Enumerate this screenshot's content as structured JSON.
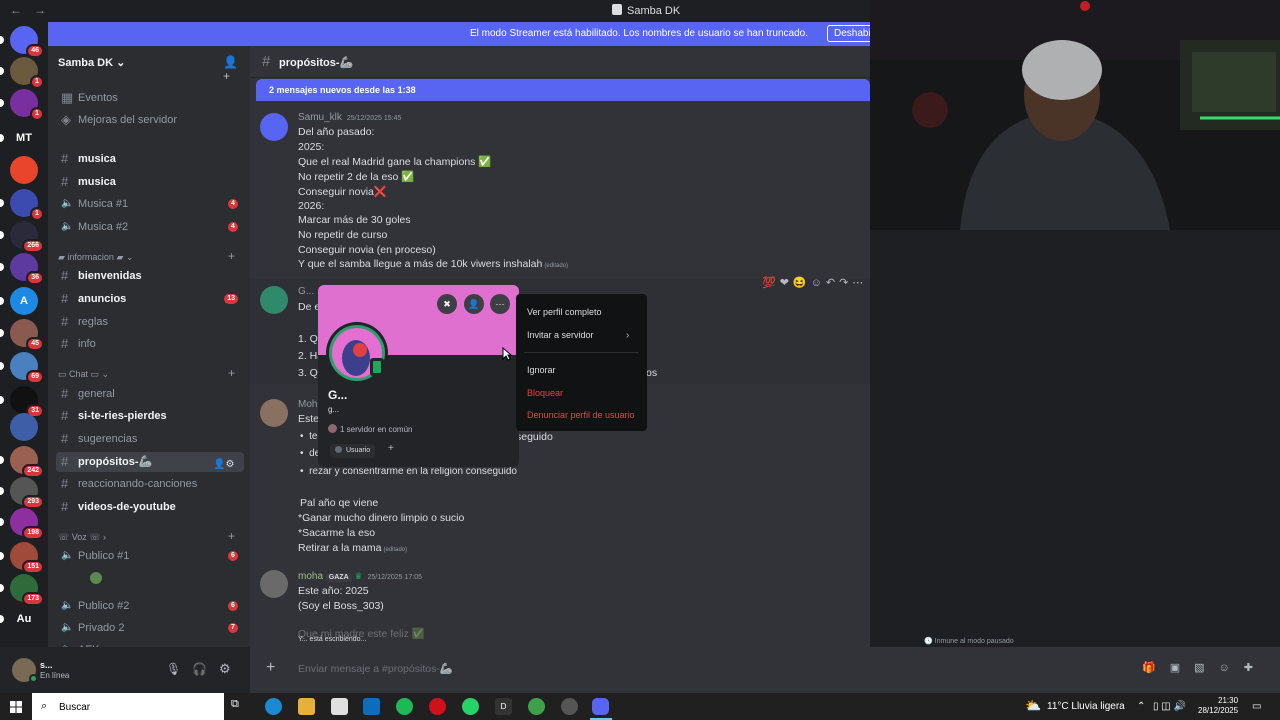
{
  "window": {
    "title": "Samba DK"
  },
  "streamer": {
    "message": "El modo Streamer está habilitado. Los nombres de usuario se han truncado.",
    "button": "Deshabilitar"
  },
  "rail": {
    "servers": [
      {
        "label": "",
        "badge": "46",
        "color": "#5865f2"
      },
      {
        "label": "",
        "badge": "1",
        "color": "#6b5a3d"
      },
      {
        "label": "",
        "badge": "1",
        "color": "#7a2fa0"
      },
      {
        "label": "MT",
        "badge": "",
        "color": "#1e1f22"
      },
      {
        "label": "",
        "badge": "",
        "color": "#e8452c"
      },
      {
        "label": "",
        "badge": "1",
        "color": "#3b4bb0"
      },
      {
        "label": "",
        "badge": "266",
        "color": "#2a2a3a"
      },
      {
        "label": "",
        "badge": "36",
        "color": "#5d3aa0"
      },
      {
        "label": "A",
        "badge": "",
        "color": "#1e88e5"
      },
      {
        "label": "",
        "badge": "45",
        "color": "#8a5a50"
      },
      {
        "label": "",
        "badge": "69",
        "color": "#4a7fc0"
      },
      {
        "label": "",
        "badge": "31",
        "color": "#111111"
      },
      {
        "label": "",
        "badge": "",
        "color": "#3e5fa8"
      },
      {
        "label": "",
        "badge": "242",
        "color": "#9a6050"
      },
      {
        "label": "",
        "badge": "293",
        "color": "#555555"
      },
      {
        "label": "",
        "badge": "198",
        "color": "#8e2fa0"
      },
      {
        "label": "",
        "badge": "151",
        "color": "#a04a3a"
      },
      {
        "label": "",
        "badge": "173",
        "color": "#2e6a3a"
      },
      {
        "label": "Au",
        "badge": "",
        "color": "#1e1f22"
      }
    ]
  },
  "sidebar": {
    "server_name": "Samba DK",
    "top_items": [
      "Eventos",
      "Mejoras del servidor"
    ],
    "categories": {
      "info": "informacion",
      "chat": "Chat",
      "voz": "Voz"
    },
    "channels": [
      {
        "name": "musica",
        "type": "text",
        "bold": true
      },
      {
        "name": "musica",
        "type": "text",
        "bold": true
      },
      {
        "name": "Musica #1",
        "type": "voice",
        "count": "4"
      },
      {
        "name": "Musica #2",
        "type": "voice",
        "count": "4"
      },
      {
        "name": "bienvenidas",
        "type": "text",
        "bold": true
      },
      {
        "name": "anuncios",
        "type": "text",
        "bold": true,
        "count": "13"
      },
      {
        "name": "reglas",
        "type": "text"
      },
      {
        "name": "info",
        "type": "text"
      },
      {
        "name": "general",
        "type": "text"
      },
      {
        "name": "si-te-ries-pierdes",
        "type": "text",
        "bold": true
      },
      {
        "name": "sugerencias",
        "type": "text"
      },
      {
        "name": "propósitos-🦾",
        "type": "text",
        "selected": true
      },
      {
        "name": "reaccionando-canciones",
        "type": "text"
      },
      {
        "name": "videos-de-youtube",
        "type": "text",
        "bold": true
      },
      {
        "name": "Publico #1",
        "type": "voice",
        "count": "6"
      },
      {
        "name": "Publico #2",
        "type": "voice",
        "count": "6"
      },
      {
        "name": "Privado 2",
        "type": "voice",
        "count": "7"
      },
      {
        "name": "AFK",
        "type": "voice"
      }
    ]
  },
  "userbar": {
    "name": "s...",
    "status": "En línea"
  },
  "chat": {
    "channel": "propósitos-🦾",
    "new_messages": "2 mensajes nuevos desde las 1:38",
    "messages": [
      {
        "author": "Samu_klk",
        "timestamp": "25/12/2025 15:45",
        "lines": [
          "Del año pasado:",
          "2025:",
          "Que el real Madrid gane la champions ✅",
          "No repetir 2 de la eso ✅",
          "Conseguir novia❌",
          "2026:",
          "Marcar más de 30 goles",
          "No repetir de curso",
          "Conseguir novia (en proceso)",
          "Y que el samba llegue a más de 10k viwers inshalah"
        ],
        "edited": "(editado)"
      },
      {
        "author": "G...",
        "lines": [
          "De e",
          "",
          "1. Qu",
          "2. Ha",
          "3. Qu"
        ],
        "trail": "os"
      },
      {
        "author": "Moh",
        "lines": [
          "Este"
        ],
        "bullets": [
          "te",
          "de",
          "rezar y consentrarme en la religion conseguido"
        ],
        "bullet_tail": "seguido",
        "after": [
          "Pal año qe viene",
          "*Ganar mucho dinero limpio o sucio",
          "*Sacarme la  eso",
          "Retirar a la mama"
        ],
        "edited": "(editado)"
      },
      {
        "author": "moha",
        "tag": "GAZA",
        "timestamp": "25/12/2025 17:05",
        "lines": [
          "Este año: 2025",
          "(Soy el Boss_303)"
        ]
      },
      {
        "author": "",
        "lines": [
          "Que mi madre este feliz ✅"
        ]
      }
    ],
    "typing": "Y... está escribiendo...",
    "immune": "Inmune al modo pausado",
    "composer_placeholder": "Enviar mensaje a #propósitos-🦾"
  },
  "profile": {
    "display_name": "G...",
    "username": "g...",
    "common": "1 servidor en común",
    "role": "Usuario",
    "role_add": "+"
  },
  "context_menu": {
    "items": [
      "Ver perfil completo",
      "Invitar a servidor",
      "Ignorar",
      "Bloquear",
      "Denunciar perfil de usuario"
    ]
  },
  "taskbar": {
    "search": "Buscar",
    "weather": "11°C  Lluvia ligera",
    "time": "21:30",
    "date": "28/12/2025"
  },
  "colors": {
    "blurple": "#5865f2",
    "danger": "#f23f42",
    "banner": "#e070d0",
    "online": "#23a55a"
  }
}
